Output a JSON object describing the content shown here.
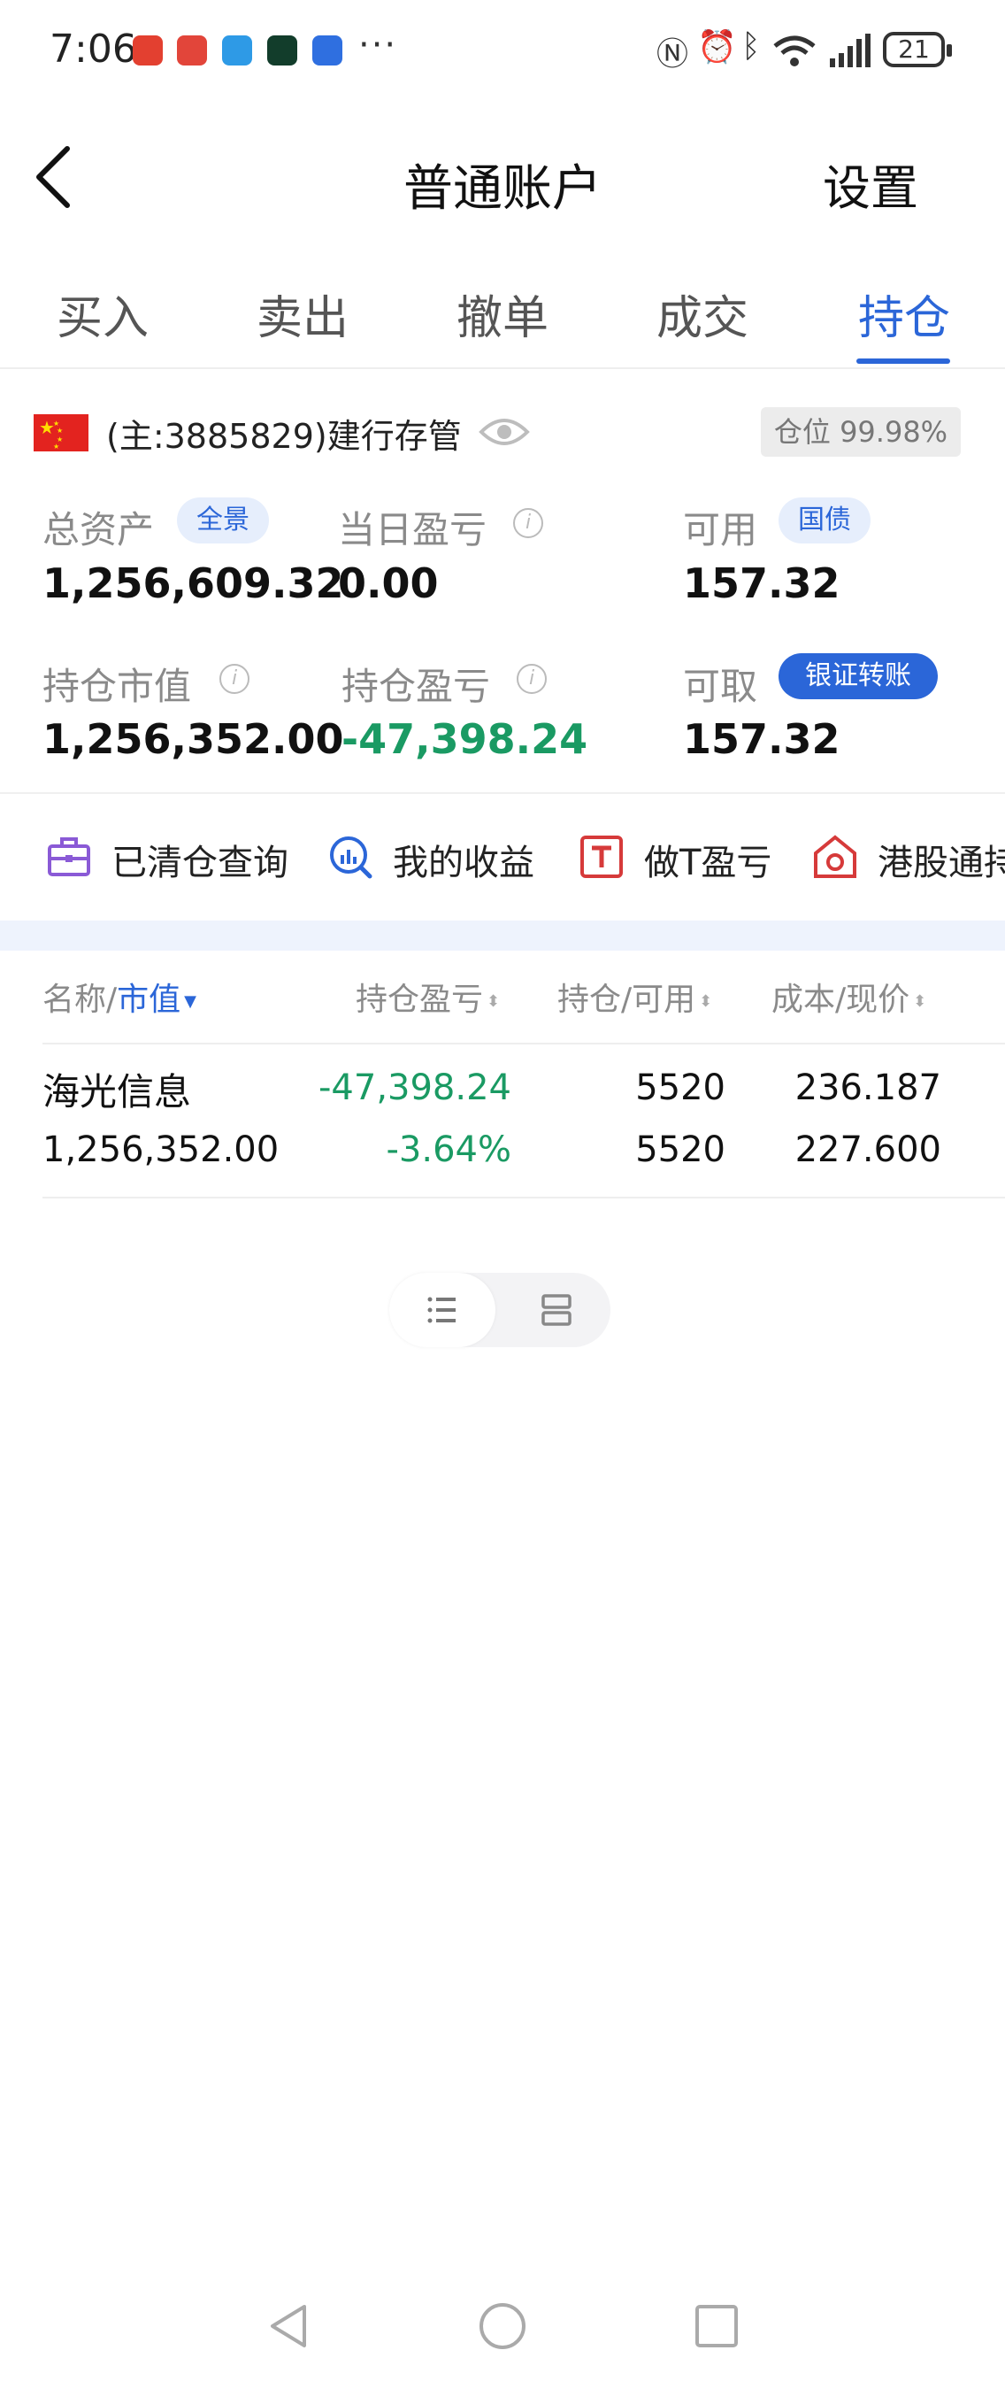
{
  "status_bar": {
    "time": "7:06",
    "battery": "21",
    "more": "···"
  },
  "header": {
    "title": "普通账户",
    "settings_label": "设置"
  },
  "tabs": [
    {
      "label": "买入"
    },
    {
      "label": "卖出"
    },
    {
      "label": "撤单"
    },
    {
      "label": "成交"
    },
    {
      "label": "持仓",
      "active": true
    }
  ],
  "account": {
    "name": "(主:3885829)建行存管",
    "position_ratio": "仓位 99.98%"
  },
  "metrics": {
    "total_assets": {
      "label": "总资产",
      "badge": "全景",
      "value": "1,256,609.32"
    },
    "daily_pnl": {
      "label": "当日盈亏",
      "value": "0.00"
    },
    "available": {
      "label": "可用",
      "badge": "国债",
      "value": "157.32"
    },
    "market_value": {
      "label": "持仓市值",
      "value": "1,256,352.00"
    },
    "position_pnl": {
      "label": "持仓盈亏",
      "value": "-47,398.24"
    },
    "withdrawable": {
      "label": "可取",
      "badge": "银证转账",
      "value": "157.32"
    }
  },
  "quick_actions": [
    {
      "label": "已清仓查询",
      "icon": "briefcase-icon"
    },
    {
      "label": "我的收益",
      "icon": "chart-search-icon"
    },
    {
      "label": "做T盈亏",
      "icon": "t-box-icon"
    },
    {
      "label": "港股通持",
      "icon": "hk-flower-icon"
    }
  ],
  "table": {
    "headers": {
      "name_prefix": "名称/",
      "name_sort": "市值",
      "pnl": "持仓盈亏",
      "qty": "持仓/可用",
      "cost": "成本/现价"
    },
    "rows": [
      {
        "name": "海光信息",
        "market_value": "1,256,352.00",
        "pnl": "-47,398.24",
        "pnl_pct": "-3.64%",
        "position": "5520",
        "available": "5520",
        "cost": "236.187",
        "price": "227.600"
      }
    ]
  },
  "colors": {
    "accent": "#2b66d8",
    "loss_green": "#1a9a63"
  }
}
